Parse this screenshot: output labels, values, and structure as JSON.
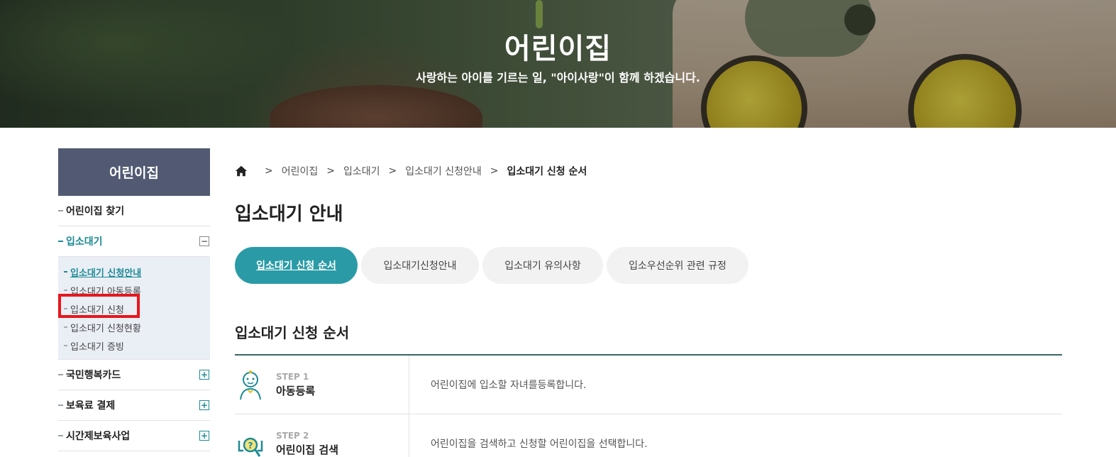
{
  "hero": {
    "title": "어린이집",
    "subtitle": "사랑하는 아이를 기르는 일, \"아이사랑\"이 함께 하겠습니다."
  },
  "sidebar": {
    "heading": "어린이집",
    "items": [
      {
        "label": "어린이집 찾기"
      },
      {
        "label": "입소대기",
        "expanded": true,
        "toggle": "−",
        "sub_items": [
          {
            "label": "입소대기 신청안내",
            "current": true
          },
          {
            "label": "입소대기 아동등록"
          },
          {
            "label": "입소대기 신청",
            "highlighted": true
          },
          {
            "label": "입소대기 신청현황"
          },
          {
            "label": "입소대기 증빙"
          }
        ]
      },
      {
        "label": "국민행복카드",
        "toggle": "+"
      },
      {
        "label": "보육료 결제",
        "toggle": "+"
      },
      {
        "label": "시간제보육사업",
        "toggle": "+"
      }
    ]
  },
  "breadcrumb": [
    "어린이집",
    "입소대기",
    "입소대기 신청안내",
    "입소대기 신청 순서"
  ],
  "page_title": "입소대기 안내",
  "tabs": [
    {
      "label": "입소대기 신청 순서",
      "active": true
    },
    {
      "label": "입소대기신청안내"
    },
    {
      "label": "입소대기 유의사항"
    },
    {
      "label": "입소우선순위 관련 규정"
    }
  ],
  "section_title": "입소대기 신청 순서",
  "steps": [
    {
      "step": "STEP 1",
      "name": "아동등록",
      "desc": "어린이집에 입소할 자녀를등록합니다.",
      "icon": "child-icon"
    },
    {
      "step": "STEP 2",
      "name": "어린이집 검색",
      "desc": "어린이집을 검색하고 신청할 어린이집을 선택합니다.",
      "icon": "search-question-icon"
    }
  ],
  "colors": {
    "accent": "#2a9ba6",
    "sidebar_header": "#515a72",
    "highlight": "#e8161d"
  }
}
